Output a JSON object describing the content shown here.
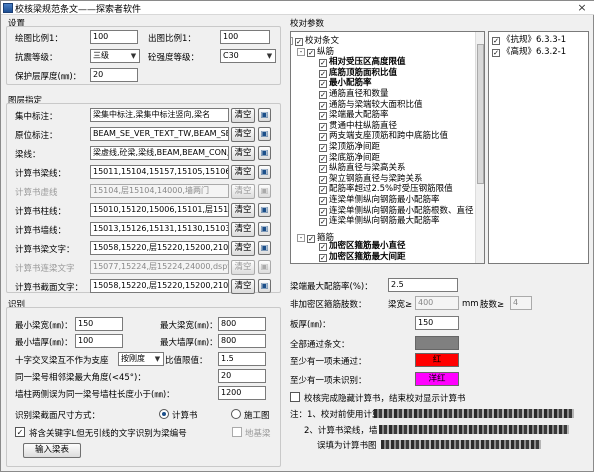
{
  "window": {
    "title": "校核梁规范条文——探索者软件",
    "close": "×"
  },
  "settings": {
    "header": "设置",
    "draw_scale_label": "绘图比例1：",
    "draw_scale": "100",
    "out_scale_label": "出图比例1：",
    "out_scale": "100",
    "seismic_label": "抗震等级：",
    "seismic": "三级",
    "concrete_label": "砼强度等级：",
    "concrete": "C30",
    "cover_label": "保护层厚度(㎜)：",
    "cover": "20"
  },
  "layers": {
    "header": "图层指定",
    "rows": [
      {
        "label": "集中标注：",
        "value": "梁集中标注,梁集中标注竖向,梁名",
        "clear": "清空",
        "enabled": true
      },
      {
        "label": "原位标注：",
        "value": "BEAM_SE_VER_TEXT_TW,BEAM_SE_VE",
        "clear": "清空",
        "enabled": true
      },
      {
        "label": "梁线：",
        "value": "梁虚线,砼梁,梁线,BEAM,BEAM_CON,B",
        "clear": "清空",
        "enabled": true
      },
      {
        "label": "计算书梁线：",
        "value": "15011,15104,15157,15105,15106,",
        "clear": "清空",
        "enabled": true
      },
      {
        "label": "计算书虚线",
        "value": "15104,层15104,14000,墙两门",
        "clear": "清空",
        "enabled": false
      },
      {
        "label": "计算书柱线：",
        "value": "15010,15120,15006,15101,层1510",
        "clear": "清空",
        "enabled": true
      },
      {
        "label": "计算书墙线：",
        "value": "15013,15126,15131,15130,15103,",
        "clear": "清空",
        "enabled": true
      },
      {
        "label": "计算书梁文字：",
        "value": "15058,15220,层15220,15200,2100",
        "clear": "清空",
        "enabled": true
      },
      {
        "label": "计算书连梁文字",
        "value": "15077,15224,层15224,24000,dspt",
        "clear": "清空",
        "enabled": false
      },
      {
        "label": "计算书截面文字：",
        "value": "15058,15220,层15220,15200,2100",
        "clear": "清空",
        "enabled": true
      }
    ]
  },
  "recognize": {
    "header": "识别",
    "min_width_label": "最小梁宽(㎜)：",
    "min_width": "150",
    "max_width_label": "最大梁宽(㎜)：",
    "max_width": "800",
    "min_wall_label": "最小墙厚(㎜)：",
    "min_wall": "100",
    "max_wall_label": "最大墙厚(㎜)：",
    "max_wall": "800",
    "cross_label": "十字交叉梁互不作为支座",
    "cross_select": "按刚度",
    "ratio_label": "比值限值：",
    "ratio": "1.5",
    "angle_label": "同一梁号相邻梁最大角度(<45°)：",
    "angle": "20",
    "len_label": "墙柱两侧误为同一梁号墙柱长度小于(㎜)：",
    "len": "1200",
    "text_method_label": "识别梁截面尺寸方式：",
    "radio_calc": "计算书",
    "radio_plan": "施工图",
    "keyword_label": "将含关键字L但无引线的文字识别为梁编号",
    "base_label": "地基梁",
    "input_button": "输入梁表"
  },
  "check": {
    "header": "校对参数",
    "tree": [
      {
        "text": "校对条文",
        "level": 0,
        "checked": true,
        "exp": "-",
        "bold": false
      },
      {
        "text": "纵筋",
        "level": 1,
        "checked": true,
        "exp": "-",
        "bold": false
      },
      {
        "text": "相对受压区高度限值",
        "level": 2,
        "checked": true,
        "bold": true
      },
      {
        "text": "底筋顶筋面积比值",
        "level": 2,
        "checked": true,
        "bold": true
      },
      {
        "text": "最小配筋率",
        "level": 2,
        "checked": true,
        "bold": true
      },
      {
        "text": "通筋直径和数量",
        "level": 2,
        "checked": true,
        "bold": false
      },
      {
        "text": "通筋与梁端较大面积比值",
        "level": 2,
        "checked": true,
        "bold": false
      },
      {
        "text": "梁端最大配筋率",
        "level": 2,
        "checked": true,
        "bold": false
      },
      {
        "text": "贯通中柱纵筋直径",
        "level": 2,
        "checked": true,
        "bold": false
      },
      {
        "text": "两支端支座顶筋和跨中底筋比值",
        "level": 2,
        "checked": true,
        "bold": false
      },
      {
        "text": "梁顶筋净间距",
        "level": 2,
        "checked": true,
        "bold": false
      },
      {
        "text": "梁底筋净间距",
        "level": 2,
        "checked": true,
        "bold": false
      },
      {
        "text": "纵筋直径与梁高关系",
        "level": 2,
        "checked": true,
        "bold": false
      },
      {
        "text": "架立钢筋直径与梁跨关系",
        "level": 2,
        "checked": true,
        "bold": false
      },
      {
        "text": "配筋率超过2.5%时受压钢筋限值",
        "level": 2,
        "checked": true,
        "bold": false
      },
      {
        "text": "连梁单侧纵向钢筋最小配筋率",
        "level": 2,
        "checked": true,
        "bold": false
      },
      {
        "text": "连梁单侧纵向钢筋最小配筋根数、直径",
        "level": 2,
        "checked": true,
        "bold": false
      },
      {
        "text": "连梁单侧纵向钢筋最大配筋率",
        "level": 2,
        "checked": true,
        "bold": false
      },
      {
        "text": "箍筋",
        "level": 1,
        "checked": true,
        "exp": "-",
        "bold": false
      },
      {
        "text": "加密区箍筋最小直径",
        "level": 2,
        "checked": true,
        "bold": true
      },
      {
        "text": "加密区箍筋最大间距",
        "level": 2,
        "checked": true,
        "bold": true
      }
    ],
    "codes": [
      {
        "text": "《抗规》6.3.3-1",
        "checked": true
      },
      {
        "text": "《高规》6.3.2-1",
        "checked": true
      }
    ],
    "max_ratio_label": "梁端最大配筋率(%)：",
    "max_ratio": "2.5",
    "stirrup_label": "非加密区箍筋肢数：",
    "beam_width_label": "梁宽≥",
    "beam_width": "400",
    "mm": "mm",
    "legs_label": "肢数≥",
    "legs": "4",
    "slab_label": "板厚(㎜)：",
    "slab": "150",
    "all_pass_label": "全部通过条文：",
    "all_pass_color": "#808080",
    "fail_label": "至少有一项未通过：",
    "fail_text": "红",
    "fail_color": "#ff0000",
    "unknown_label": "至少有一项未识别：",
    "unknown_text": "洋红",
    "unknown_color": "#ff00ff",
    "show_calc_label": "校核完成隐藏计算书，结束校对显示计算书",
    "note_prefix": "注：1、校对前使用计算",
    "note2": "2、计算书梁线，墙",
    "note3": "误填为计算书图"
  }
}
